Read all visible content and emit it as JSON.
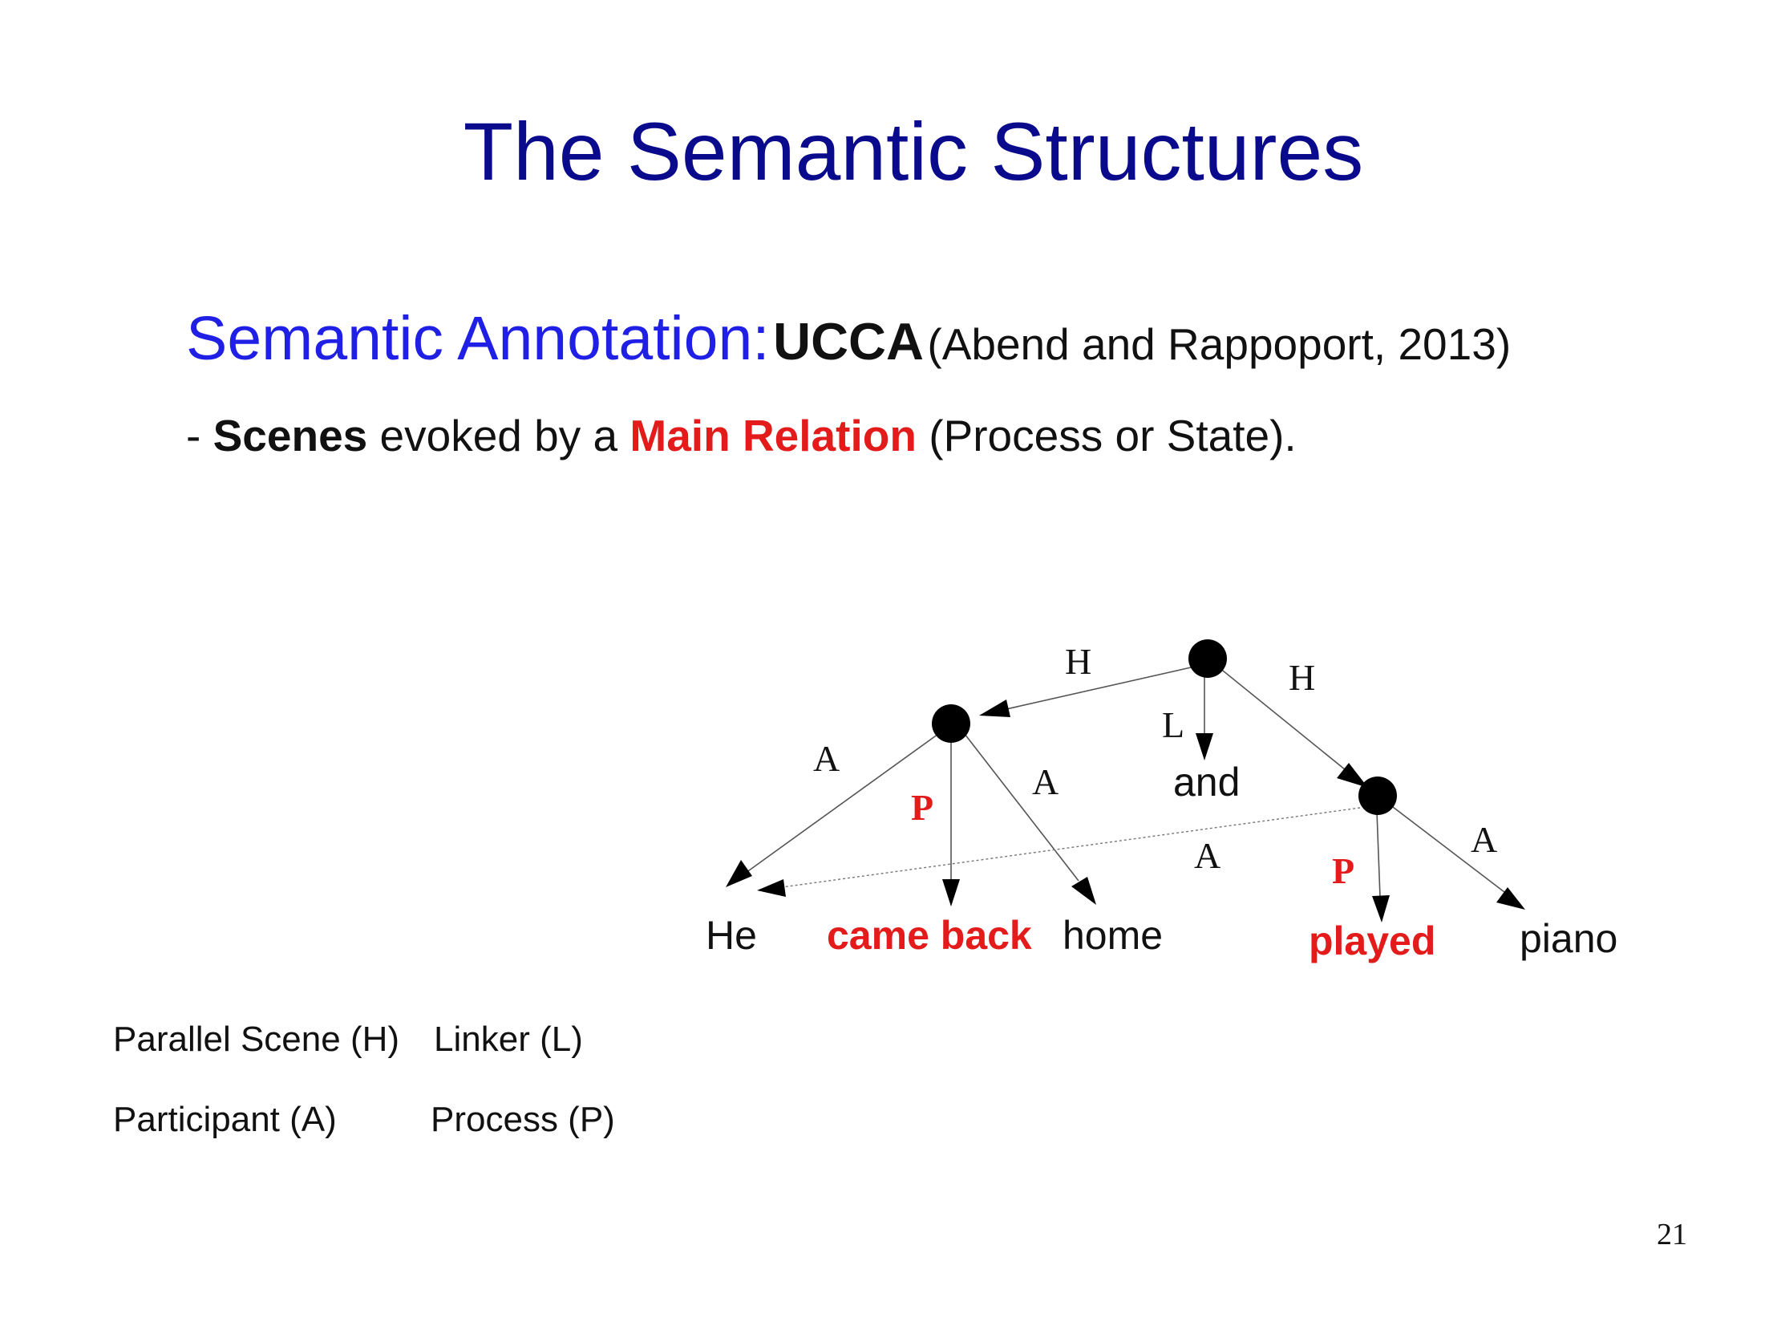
{
  "title": "The Semantic Structures",
  "subheading": {
    "lead": "Semantic Annotation:",
    "bold": "UCCA",
    "citation": "(Abend and Rappoport, 2013)"
  },
  "bullet": {
    "dash": "- ",
    "scenes": "Scenes",
    "middle": " evoked by a ",
    "main_relation": "Main Relation",
    "rest": " (Process or State)."
  },
  "diagram": {
    "nodes": [
      "root",
      "scene-1",
      "scene-2"
    ],
    "edge_labels": {
      "root_to_scene1": "H",
      "root_to_scene2": "H",
      "root_to_and": "L",
      "scene1_to_he": "A",
      "scene1_to_came_back": "P",
      "scene1_to_home": "A",
      "scene2_to_he": "A",
      "scene2_to_played": "P",
      "scene2_to_piano": "A"
    },
    "words": {
      "he": "He",
      "came_back": "came back",
      "home": "home",
      "and": "and",
      "played": "played",
      "piano": "piano"
    },
    "colors": {
      "main_relation": "#e31b1b",
      "node": "#000000",
      "edge": "#555555"
    }
  },
  "legend": {
    "parallel_scene": "Parallel Scene (H)",
    "linker": "Linker (L)",
    "participant": "Participant (A)",
    "process": "Process (P)"
  },
  "page_number": "21"
}
